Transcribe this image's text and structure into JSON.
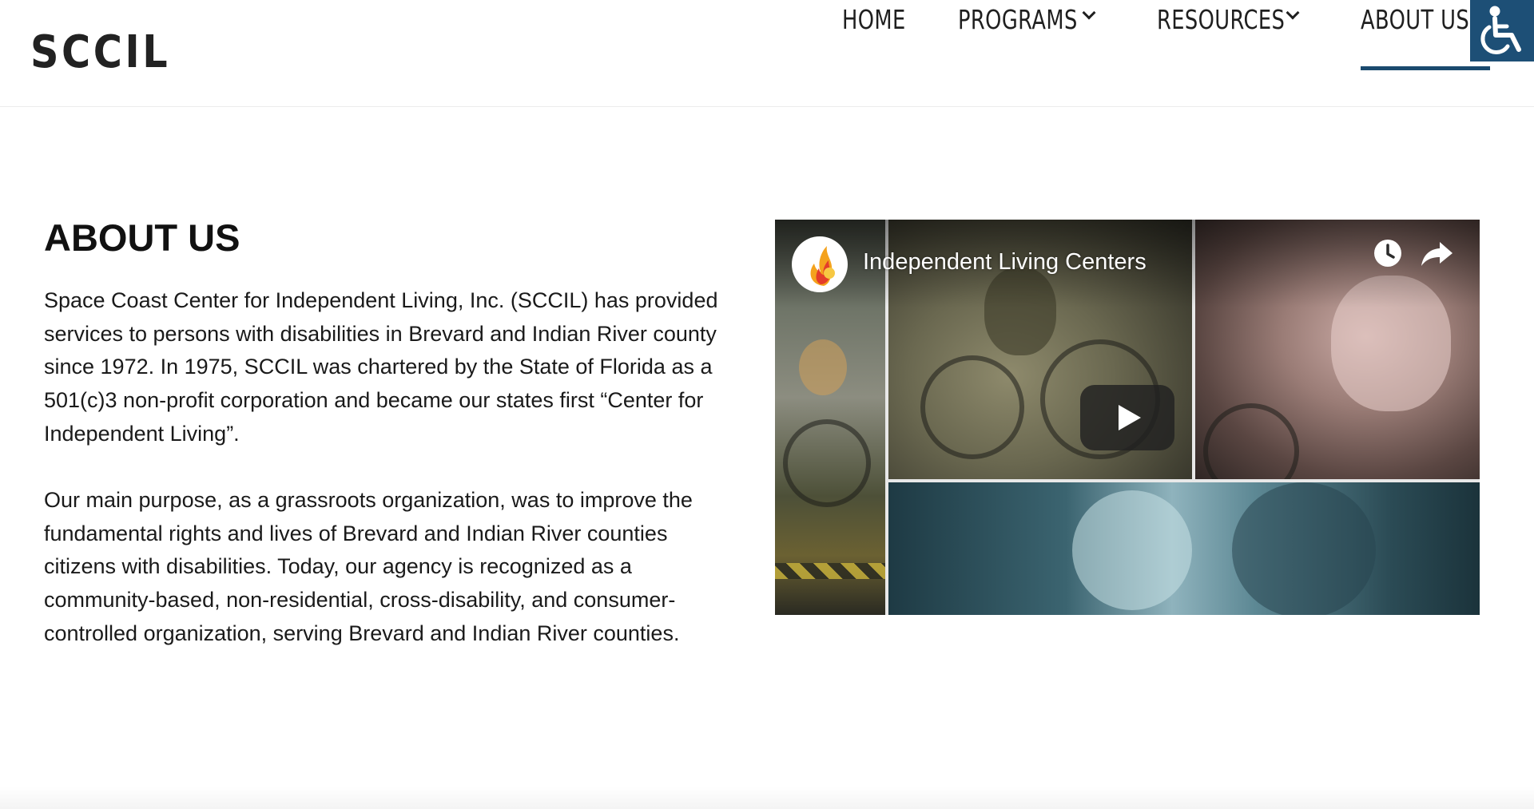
{
  "header": {
    "logo": "SCCIL",
    "nav": [
      {
        "label": "HOME",
        "has_dropdown": false,
        "active": false
      },
      {
        "label": "PROGRAMS",
        "has_dropdown": true,
        "active": false
      },
      {
        "label": "RESOURCES",
        "has_dropdown": true,
        "active": false
      },
      {
        "label": "ABOUT US",
        "has_dropdown": false,
        "active": true
      }
    ],
    "accessibility_icon": "wheelchair-icon"
  },
  "main": {
    "title": "ABOUT US",
    "paragraphs": [
      "Space Coast Center for Independent Living, Inc. (SCCIL) has provided services to persons with disabilities in Brevard and Indian River county since 1972. In 1975, SCCIL was chartered by the State of Florida as a 501(c)3 non-profit corporation and became our states first “Center for Independent Living”.",
      "Our main purpose, as a grassroots organization, was to improve the fundamental rights and lives of Brevard and Indian River counties citizens with disabilities. Today, our agency is recognized as a community-based, non-residential, cross-disability, and consumer-controlled organization, serving Brevard and Indian River counties."
    ]
  },
  "video": {
    "title": "Independent Living Centers",
    "icons": [
      "channel-logo-icon",
      "watch-later-icon",
      "share-icon",
      "play-icon"
    ]
  },
  "colors": {
    "accent": "#1a4a6e",
    "accessibility_bg": "#1d4f76",
    "text": "#111111"
  }
}
